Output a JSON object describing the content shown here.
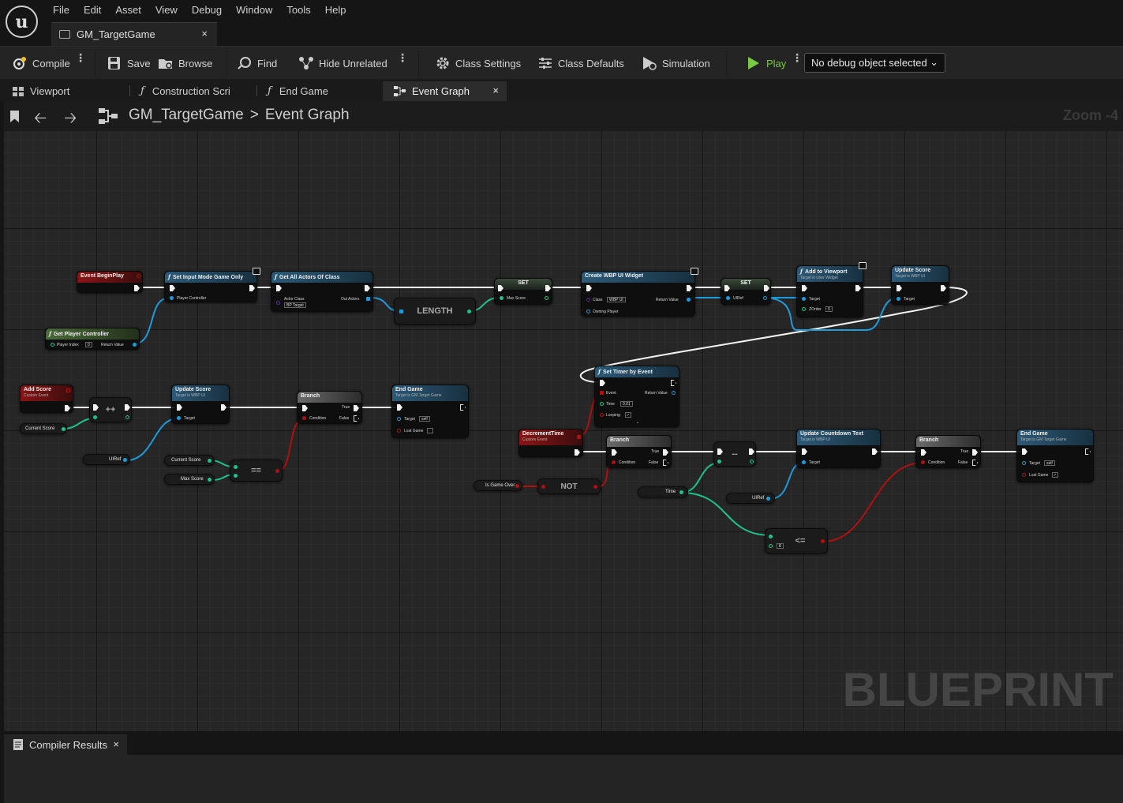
{
  "app": {
    "logo_glyph": "u",
    "menu": [
      "File",
      "Edit",
      "Asset",
      "View",
      "Debug",
      "Window",
      "Tools",
      "Help"
    ],
    "document_tab": "GM_TargetGame",
    "document_tab_close": "×"
  },
  "toolbar": {
    "compile": "Compile",
    "save": "Save",
    "browse": "Browse",
    "find": "Find",
    "hide_unrelated": "Hide Unrelated",
    "class_settings": "Class Settings",
    "class_defaults": "Class Defaults",
    "simulation": "Simulation",
    "play": "Play",
    "debug_object": "No debug object selected",
    "kebab": "⋮"
  },
  "editor_tabs": [
    {
      "label": "Viewport"
    },
    {
      "label": "Construction Scri"
    },
    {
      "label": "End Game"
    },
    {
      "label": "Event Graph"
    }
  ],
  "editor_tab_close": "×",
  "graph_header": {
    "back": "🡠",
    "forward": "🡢",
    "crumb_root": "GM_TargetGame",
    "crumb_sep": ">",
    "crumb_leaf": "Event Graph",
    "zoom": "Zoom -4"
  },
  "watermark": "BLUEPRINT",
  "nodes": {
    "begin_play": "Event BeginPlay",
    "set_input": {
      "title": "Set Input Mode Game Only",
      "pin": "Player Controller"
    },
    "get_pc": {
      "title": "Get Player Controller",
      "pin_in": "Player Index",
      "val": "0",
      "pin_out": "Return Value"
    },
    "get_all": {
      "title": "Get All Actors Of Class",
      "pin_class": "Actor Class",
      "class_val": "BP Target",
      "pin_out": "Out Actors"
    },
    "length": "LENGTH",
    "set1": {
      "title": "SET",
      "pin": "Max Score"
    },
    "create_widget": {
      "title": "Create WBP UI Widget",
      "pin_class": "Class",
      "class_val": "WBP UI",
      "pin_owner": "Owning Player",
      "pin_out": "Return Value"
    },
    "set2": {
      "title": "SET",
      "pin": "UIRef"
    },
    "add_viewport": {
      "title": "Add to Viewport",
      "sub": "Target is User Widget",
      "pin_target": "Target",
      "pin_z": "ZOrder",
      "z_val": "0"
    },
    "update_score1": {
      "title": "Update Score",
      "sub": "Target is WBP UI",
      "pin": "Target"
    },
    "set_timer": {
      "title": "Set Timer by Event",
      "pin_event": "Event",
      "pin_time": "Time",
      "time_val": "0.01",
      "pin_loop": "Looping",
      "pin_out": "Return Value",
      "expand": "⌄"
    },
    "add_score": {
      "title": "Add Score",
      "sub": "Custom Event"
    },
    "current_score1": "Current Score",
    "inc": "++",
    "update_score2": {
      "title": "Update Score",
      "sub": "Target is WBP UI",
      "pin": "Target"
    },
    "uiref1": "UIRef",
    "current_score2": "Current Score",
    "max_score": "Max Score",
    "eq": "==",
    "branch1": {
      "title": "Branch",
      "cond": "Condition",
      "t": "True",
      "f": "False"
    },
    "end_game1": {
      "title": "End Game",
      "sub": "Target is GM Target Game",
      "pin_target": "Target",
      "target_val": "self",
      "pin_lost": "Lost Game"
    },
    "decrement": {
      "title": "DecrementTime",
      "sub": "Custom Event"
    },
    "is_game_over": "Is Game Over",
    "not": "NOT",
    "branch2": {
      "title": "Branch",
      "cond": "Condition",
      "t": "True",
      "f": "False"
    },
    "dec": "--",
    "time": "Time",
    "uiref2": "UIRef",
    "lte": {
      "op": "<=",
      "val": "0"
    },
    "update_countdown": {
      "title": "Update Countdown Text",
      "sub": "Target is WBP UI",
      "pin": "Target"
    },
    "branch3": {
      "title": "Branch",
      "cond": "Condition",
      "t": "True",
      "f": "False"
    },
    "end_game2": {
      "title": "End Game",
      "sub": "Target is GM Target Game",
      "pin_target": "Target",
      "target_val": "self",
      "pin_lost": "Lost Game",
      "lost_val": "✓"
    }
  },
  "bottom": {
    "compiler_results": "Compiler Results",
    "close": "×"
  },
  "colors": {
    "exec": "#f2f2f2",
    "object_pin": "#1e9bdc",
    "int_pin": "#1dc38f",
    "bool_pin": "#b01010",
    "play_green": "#7ac943"
  }
}
